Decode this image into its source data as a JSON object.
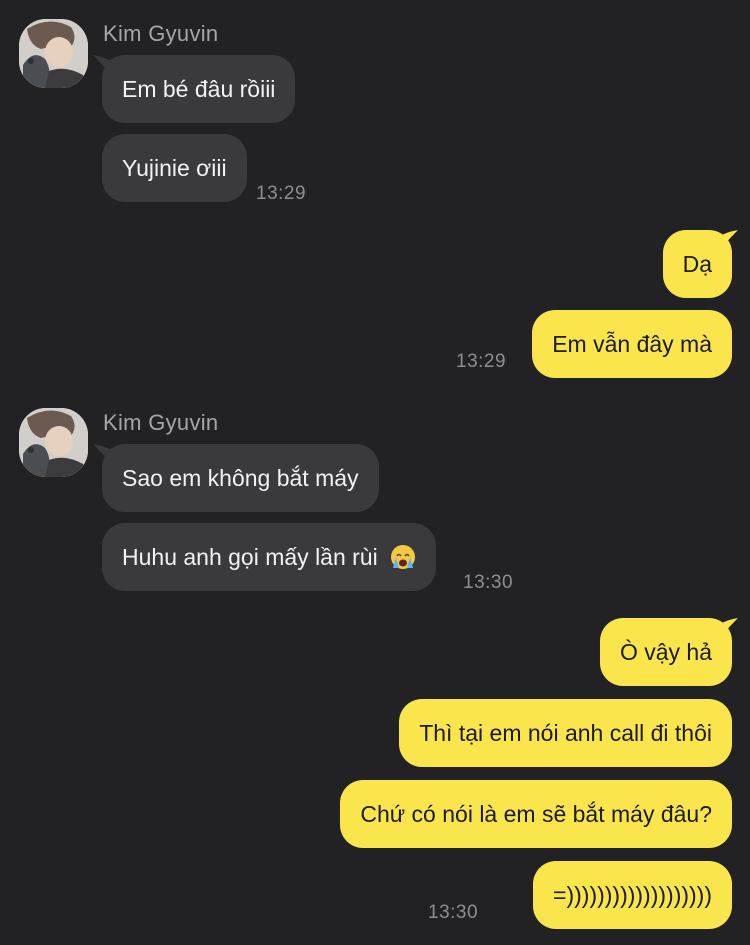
{
  "groups": [
    {
      "sender": "Kim Gyuvin",
      "messages": [
        "Em bé đâu rồiii",
        "Yujinie ơiii"
      ],
      "time": "13:29"
    },
    {
      "messages": [
        "Dạ",
        "Em vẫn đây mà"
      ],
      "time": "13:29"
    },
    {
      "sender": "Kim Gyuvin",
      "messages": [
        "Sao em không bắt máy",
        "Huhu anh gọi mấy lần rùi"
      ],
      "emoji": "crying-face-icon",
      "time": "13:30"
    },
    {
      "messages": [
        "Ò vậy hả",
        "Thì tại em nói anh call đi thôi",
        "Chứ có nói là em sẽ bắt máy đâu?",
        "=)))))))))))))))))))"
      ],
      "time": "13:30"
    }
  ],
  "colors": {
    "background": "#222224",
    "incoming_bubble": "#3a3a3c",
    "outgoing_bubble": "#fae54d",
    "sender_name": "#a6a6aa",
    "timestamp": "#8e8e92"
  }
}
